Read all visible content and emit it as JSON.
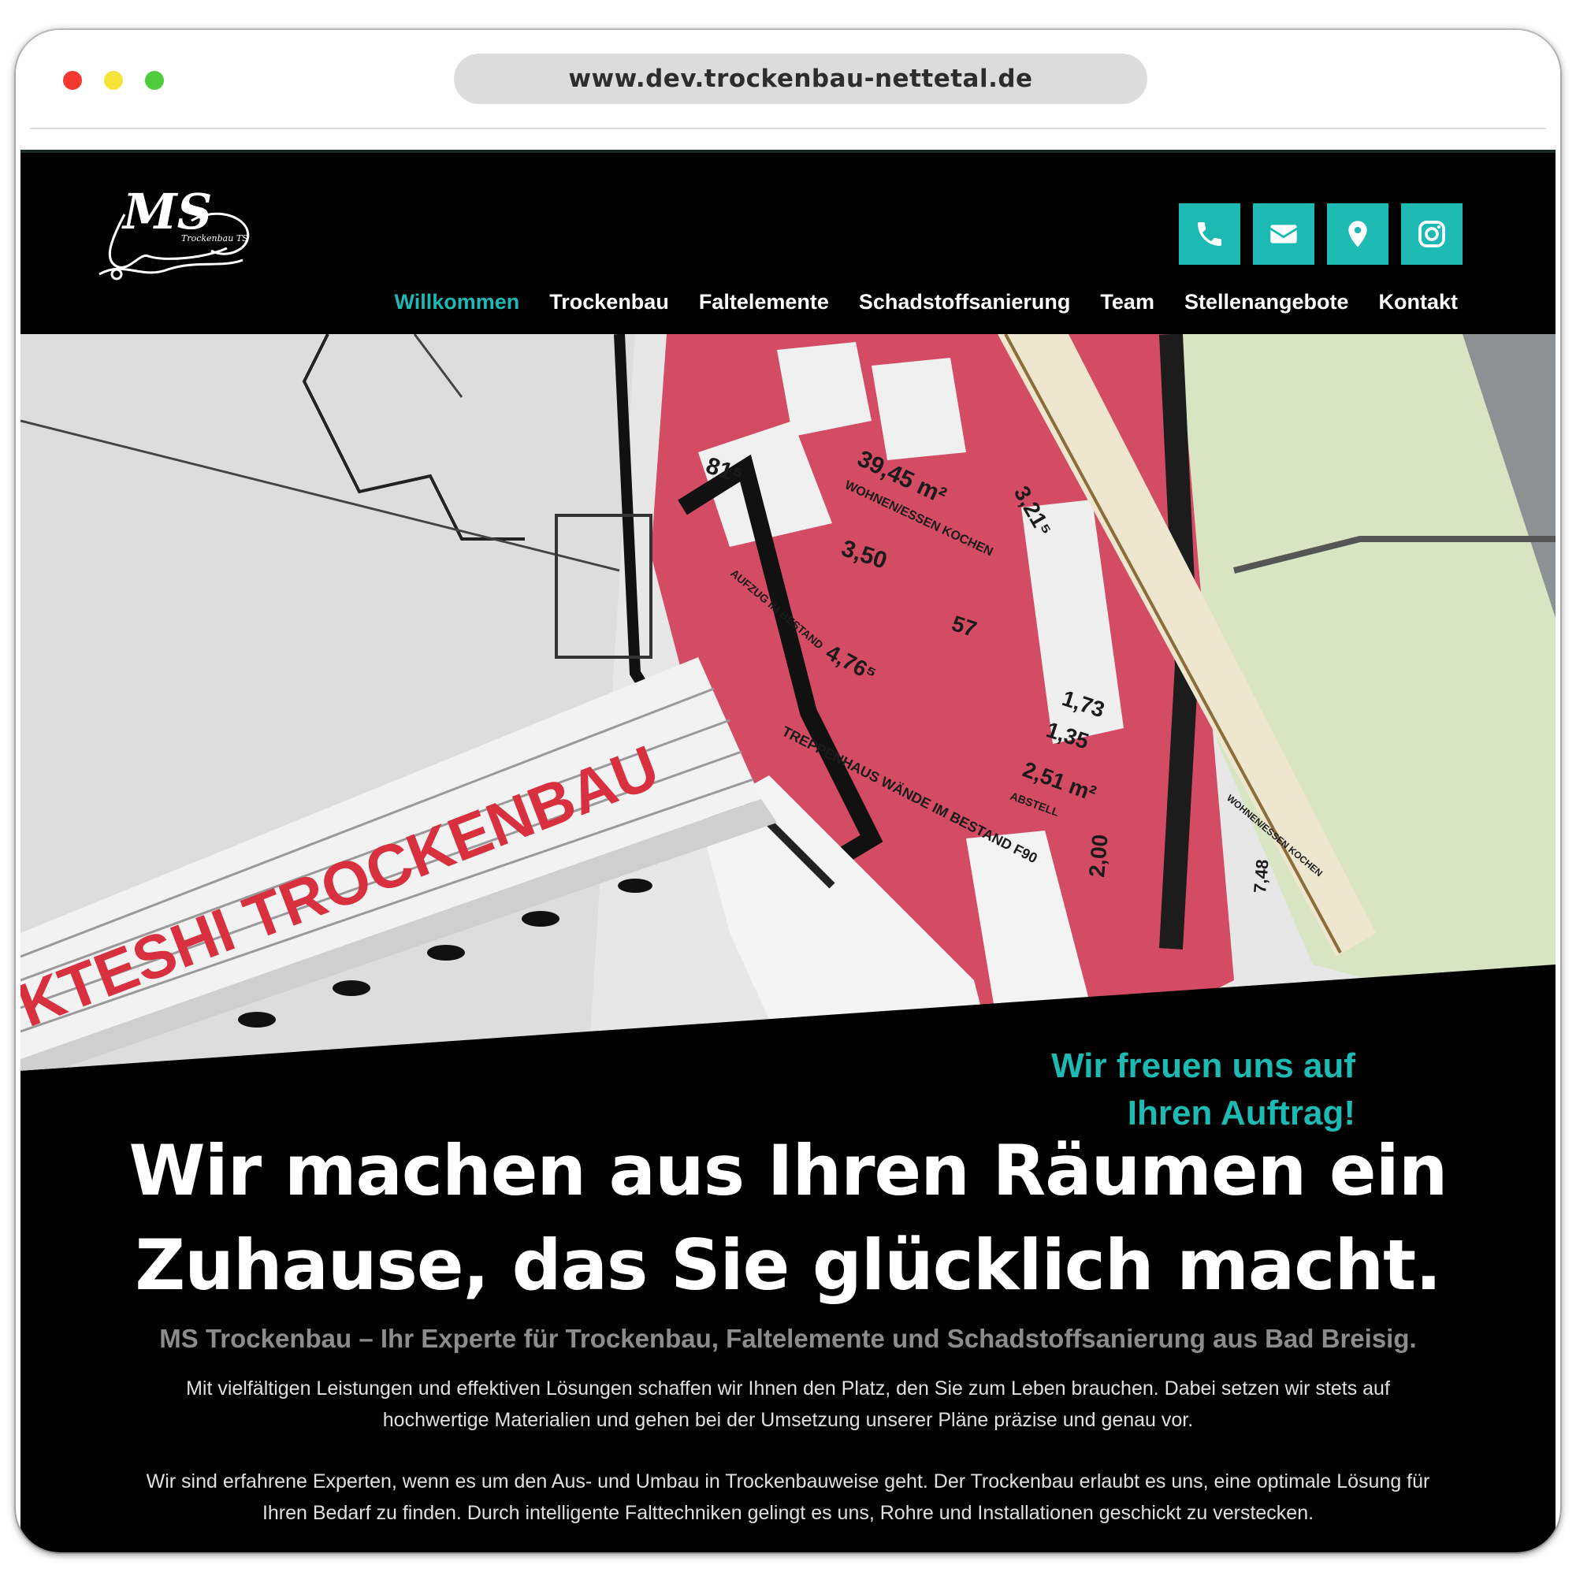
{
  "browser": {
    "url": "www.dev.trockenbau-nettetal.de"
  },
  "header": {
    "logo_text": "MS",
    "logo_subtext": "Trockenbau TS",
    "social": [
      "phone-icon",
      "email-icon",
      "location-icon",
      "instagram-icon"
    ],
    "accent_color": "#1db9b3"
  },
  "nav": {
    "items": [
      {
        "label": "Willkommen",
        "active": true
      },
      {
        "label": "Trockenbau",
        "active": false
      },
      {
        "label": "Faltelemente",
        "active": false
      },
      {
        "label": "Schadstoffsanierung",
        "active": false
      },
      {
        "label": "Team",
        "active": false
      },
      {
        "label": "Stellenangebote",
        "active": false
      },
      {
        "label": "Kontakt",
        "active": false
      }
    ]
  },
  "hero": {
    "ruler_text": "KTESHI TROCKENBAU",
    "plan_labels": [
      "81⁵",
      "39,45 m²",
      "WOHNEN/ESSEN KOCHEN",
      "3,50",
      "3,21⁵",
      "57",
      "AUFZUG IM BESTAND",
      "4,76⁵",
      "1,73",
      "1,35",
      "2,51 m²",
      "ABSTELL",
      "2,00",
      "TREPPENHAUS WÄNDE IM BESTAND F90",
      "WOHNEN/ESSEN KOCHEN",
      "7,48"
    ]
  },
  "content": {
    "slogan_line1": "Wir freuen uns auf",
    "slogan_line2": "Ihren Auftrag!",
    "headline_line1": "Wir machen aus Ihren Räumen ein",
    "headline_line2": "Zuhause, das Sie glücklich macht.",
    "subline": "MS Trockenbau – Ihr Experte für Trockenbau, Faltelemente und Schadstoffsanierung aus Bad Breisig.",
    "para1": "Mit vielfältigen Leistungen und effektiven Lösungen schaffen wir Ihnen den Platz, den Sie zum Leben brauchen. Dabei setzen wir stets auf hochwertige Materialien und gehen bei der Umsetzung unserer Pläne präzise und genau vor.",
    "para2": "Wir sind erfahrene Experten, wenn es um den Aus- und Umbau in Trockenbauweise geht. Der Trockenbau erlaubt es uns, eine optimale Lösung für Ihren Bedarf zu finden. Durch intelligente Falttechniken gelingt es uns, Rohre und Installationen geschickt zu verstecken."
  }
}
